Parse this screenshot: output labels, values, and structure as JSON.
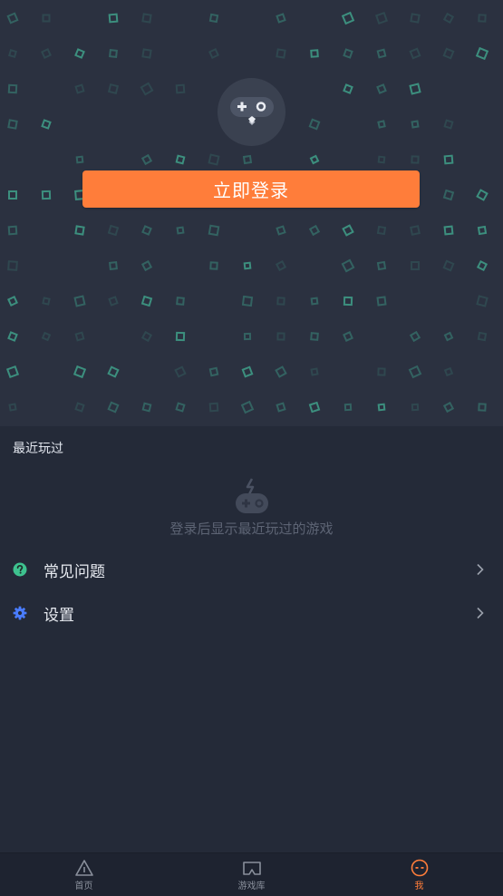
{
  "header": {
    "login_button_label": "立即登录"
  },
  "recent": {
    "title": "最近玩过",
    "empty_text": "登录后显示最近玩过的游戏"
  },
  "menu": {
    "items": [
      {
        "label": "常见问题",
        "icon": "question-icon",
        "icon_color": "#3ec28f"
      },
      {
        "label": "设置",
        "icon": "gear-icon",
        "icon_color": "#4a7dff"
      }
    ]
  },
  "bottom_nav": {
    "tabs": [
      {
        "label": "首页",
        "icon": "home-triangle-icon",
        "active": false
      },
      {
        "label": "游戏库",
        "icon": "game-library-icon",
        "active": false
      },
      {
        "label": "我",
        "icon": "profile-face-icon",
        "active": true
      }
    ]
  },
  "colors": {
    "accent": "#ff7d3a",
    "background": "#242a38",
    "hero_background": "#2b3140",
    "pattern": "#3fa08a"
  }
}
